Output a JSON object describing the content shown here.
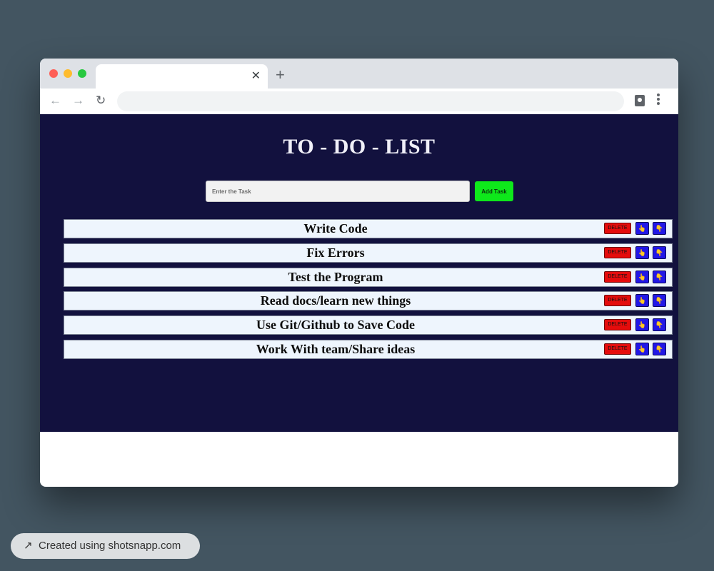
{
  "browser": {
    "tab_title": "",
    "tab_close_glyph": "✕",
    "new_tab_glyph": "+",
    "back_glyph": "←",
    "forward_glyph": "→",
    "reload_glyph": "↻",
    "address": ""
  },
  "app": {
    "title": "TO - DO - LIST",
    "input": {
      "placeholder": "Enter the Task",
      "value": ""
    },
    "add_button_label": "Add Task",
    "delete_label": "DELETE",
    "done_icon": "👆",
    "undo_icon": "👇",
    "tasks": [
      "Write Code",
      "Fix Errors",
      "Test the Program",
      "Read docs/learn new things",
      "Use Git/Github to Save Code",
      "Work With team/Share ideas"
    ]
  },
  "footer": {
    "badge_text": "Created using shotsnapp.com",
    "badge_arrow": "↗"
  },
  "colors": {
    "page_bg": "#435561",
    "app_bg": "#12113e",
    "add_button": "#0ee81b",
    "delete_button": "#e50c0c",
    "icon_button": "#2217e6",
    "task_row_bg": "#eef5fd"
  }
}
